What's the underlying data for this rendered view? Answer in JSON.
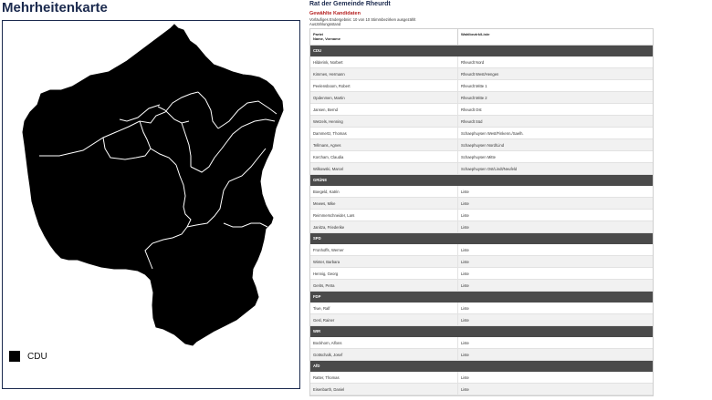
{
  "map": {
    "title": "Mehrheitenkarte",
    "legend": [
      {
        "label": "CDU",
        "color": "#000000"
      }
    ]
  },
  "council": {
    "title": "Rat der Gemeinde Rheurdt",
    "subtitle": "Gewählte Kandidaten",
    "meta_line1": "Vorläufiges Endergebnis: 10 von 10 Stimmbezirken ausgezählt",
    "meta_line2": "Auszählungsstand",
    "header_col1_line1": "Partei",
    "header_col1_line2": "Name, Vorname",
    "header_col2": "Wahlbezirk/Liste",
    "groups": [
      {
        "party": "CDU",
        "rows": [
          {
            "name": "Hilderink, Norbert",
            "district": "Rheurdt Nord"
          },
          {
            "name": "Kimmes, Hermann",
            "district": "Rheurdt West/Hengen"
          },
          {
            "name": "Peelensboom, Robert",
            "district": "Rheurdt Mitte 1"
          },
          {
            "name": "Opdenmen, Martin",
            "district": "Rheurdt Mitte 2"
          },
          {
            "name": "Jansen, Bernd",
            "district": "Rheurdt Ost"
          },
          {
            "name": "Wetzels, Henning",
            "district": "Rheurdt Süd"
          },
          {
            "name": "Dammertz, Thomas",
            "district": "Schaephuysen West/Finkenn./Saelh."
          },
          {
            "name": "Tellmans, Agnes",
            "district": "Schaephuysen Nord/Lind"
          },
          {
            "name": "Korcham, Claudia",
            "district": "Schaephuysen Mitte"
          },
          {
            "name": "Wilkowski, Marcel",
            "district": "Schaephuysen Ost/Lindt/Neufeld"
          }
        ]
      },
      {
        "party": "GRÜNE",
        "rows": [
          {
            "name": "Boegeld, Katrin",
            "district": "Liste"
          },
          {
            "name": "Mewes, Mike",
            "district": "Liste"
          },
          {
            "name": "Reimmerschneider, Lars",
            "district": "Liste"
          },
          {
            "name": "Janitza, Friederike",
            "district": "Liste"
          }
        ]
      },
      {
        "party": "SPD",
        "rows": [
          {
            "name": "Fronhoffs, Werner",
            "district": "Liste"
          },
          {
            "name": "Winter, Barbara",
            "district": "Liste"
          },
          {
            "name": "Hennig, Georg",
            "district": "Liste"
          },
          {
            "name": "Gerits, Petra",
            "district": "Liste"
          }
        ]
      },
      {
        "party": "FDP",
        "rows": [
          {
            "name": "Tiwe, Ralf",
            "district": "Liste"
          },
          {
            "name": "Gesl, Rainer",
            "district": "Liste"
          }
        ]
      },
      {
        "party": "WIR",
        "rows": [
          {
            "name": "Bockhorn, Alfons",
            "district": "Liste"
          },
          {
            "name": "Gottschalk, Josef",
            "district": "Liste"
          }
        ]
      },
      {
        "party": "AfD",
        "rows": [
          {
            "name": "Ratter, Thomas",
            "district": "Liste"
          },
          {
            "name": "Eisenbarth, Daniel",
            "district": "Liste"
          }
        ]
      }
    ]
  }
}
